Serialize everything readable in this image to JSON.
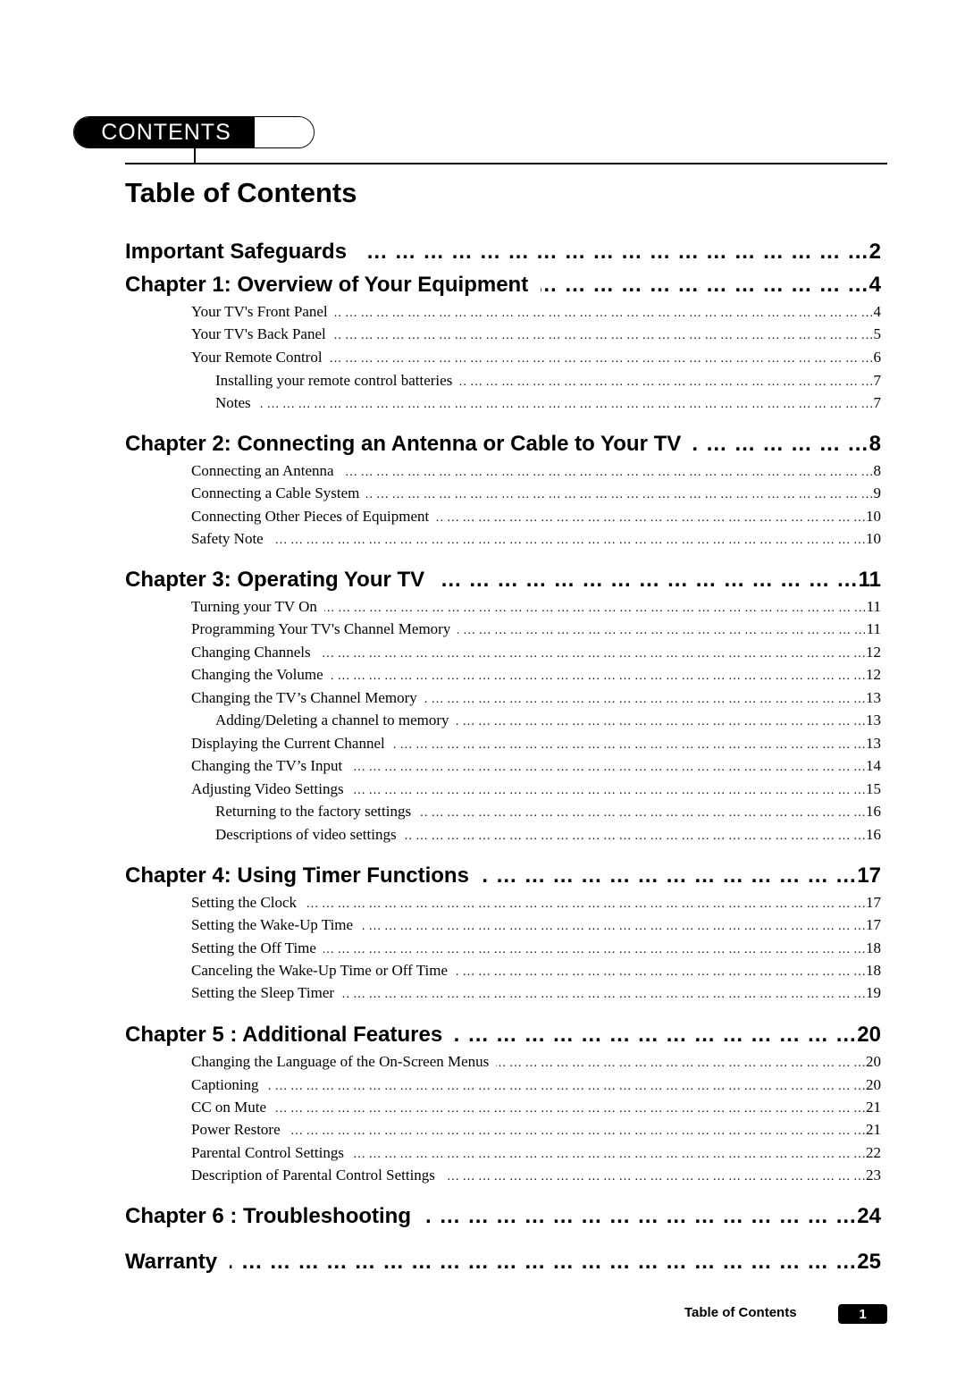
{
  "header": {
    "tab_label": "CONTENTS",
    "title": "Table of Contents"
  },
  "toc": [
    {
      "level": 1,
      "label": "Important Safeguards",
      "page": "2"
    },
    {
      "level": 1,
      "label": "Chapter 1: Overview of Your Equipment",
      "page": "4"
    },
    {
      "level": 2,
      "label": "Your TV's Front Panel",
      "page": "4"
    },
    {
      "level": 2,
      "label": "Your TV's Back Panel",
      "page": "5"
    },
    {
      "level": 2,
      "label": "Your Remote Control",
      "page": "6"
    },
    {
      "level": 3,
      "label": "Installing your remote control batteries",
      "page": "7"
    },
    {
      "level": 3,
      "label": "Notes",
      "page": "7"
    },
    {
      "level": 1,
      "label": "Chapter 2: Connecting an Antenna or Cable to Your TV",
      "page": "8"
    },
    {
      "level": 2,
      "label": "Connecting an Antenna",
      "page": "8"
    },
    {
      "level": 2,
      "label": "Connecting a Cable System",
      "page": "9"
    },
    {
      "level": 2,
      "label": "Connecting Other Pieces of Equipment",
      "page": "10"
    },
    {
      "level": 2,
      "label": "Safety Note",
      "page": "10"
    },
    {
      "level": 1,
      "label": "Chapter 3: Operating Your TV",
      "page": "11"
    },
    {
      "level": 2,
      "label": "Turning your TV On",
      "page": "11"
    },
    {
      "level": 2,
      "label": "Programming Your TV's Channel Memory",
      "page": "11"
    },
    {
      "level": 2,
      "label": "Changing Channels",
      "page": "12"
    },
    {
      "level": 2,
      "label": "Changing the Volume",
      "page": "12"
    },
    {
      "level": 2,
      "label": "Changing the TV’s Channel Memory",
      "page": "13"
    },
    {
      "level": 3,
      "label": "Adding/Deleting a channel to memory",
      "page": "13"
    },
    {
      "level": 2,
      "label": "Displaying the Current Channel",
      "page": "13"
    },
    {
      "level": 2,
      "label": "Changing the TV’s Input",
      "page": "14"
    },
    {
      "level": 2,
      "label": "Adjusting Video Settings",
      "page": "15"
    },
    {
      "level": 3,
      "label": "Returning to the factory settings",
      "page": "16"
    },
    {
      "level": 3,
      "label": "Descriptions of video settings",
      "page": "16"
    },
    {
      "level": 1,
      "label": "Chapter 4: Using Timer Functions",
      "page": "17"
    },
    {
      "level": 2,
      "label": "Setting the Clock",
      "page": "17"
    },
    {
      "level": 2,
      "label": "Setting the Wake-Up Time",
      "page": "17"
    },
    {
      "level": 2,
      "label": "Setting the Off Time",
      "page": "18"
    },
    {
      "level": 2,
      "label": "Canceling the Wake-Up Time or Off Time",
      "page": "18"
    },
    {
      "level": 2,
      "label": "Setting the Sleep Timer",
      "page": "19"
    },
    {
      "level": 1,
      "label": "Chapter 5 : Additional Features",
      "page": "20"
    },
    {
      "level": 2,
      "label": "Changing the Language of the On-Screen Menus",
      "page": "20"
    },
    {
      "level": 2,
      "label": "Captioning",
      "page": "20"
    },
    {
      "level": 2,
      "label": "CC on Mute",
      "page": "21"
    },
    {
      "level": 2,
      "label": "Power Restore",
      "page": "21"
    },
    {
      "level": 2,
      "label": "Parental Control Settings",
      "page": "22"
    },
    {
      "level": 2,
      "label": "Description of Parental Control Settings",
      "page": "23"
    },
    {
      "level": 1,
      "label": "Chapter 6 : Troubleshooting",
      "page": "24"
    },
    {
      "level": 1,
      "label": "Warranty",
      "page": "25"
    }
  ],
  "footer": {
    "section_label": "Table of Contents",
    "page_number": "1"
  }
}
